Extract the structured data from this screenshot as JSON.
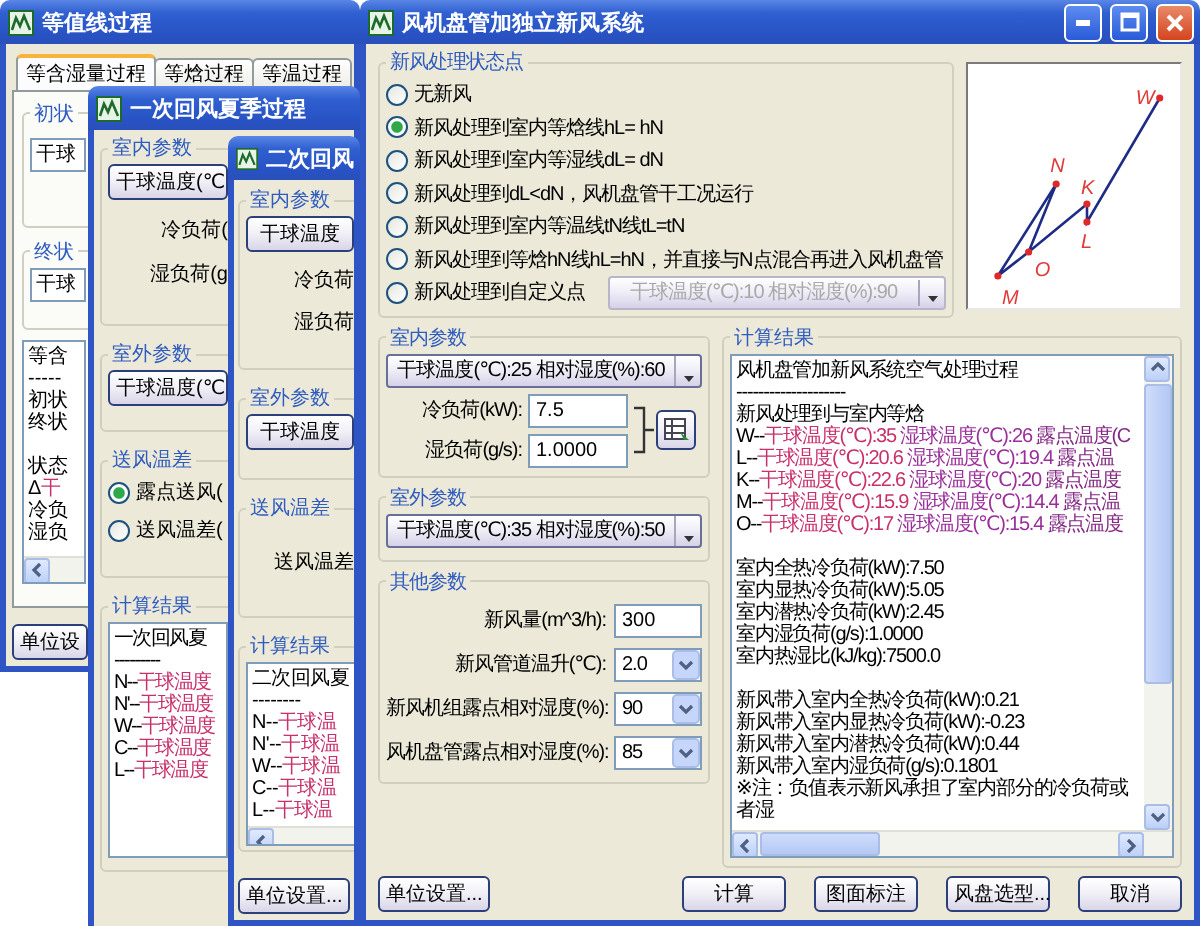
{
  "isoline_window": {
    "title": "等值线过程",
    "tabs": [
      {
        "label": "等含湿量过程",
        "selected": true
      },
      {
        "label": "等焓过程",
        "selected": false
      },
      {
        "label": "等温过程",
        "selected": false
      }
    ],
    "start_group": {
      "legend": "初状",
      "field": "干球"
    },
    "end_group": {
      "legend": "终状",
      "field": "干球"
    },
    "results": [
      {
        "kind": "plain",
        "text": "等含"
      },
      {
        "kind": "plain",
        "text": "-----"
      },
      {
        "kind": "plain",
        "text": "初状"
      },
      {
        "kind": "plain",
        "text": "终状"
      },
      {
        "kind": "blank"
      },
      {
        "kind": "plain",
        "text": "状态"
      },
      {
        "kind": "state",
        "prefix": "Δ",
        "parts": [
          "干"
        ]
      },
      {
        "kind": "plain",
        "text": "冷负"
      },
      {
        "kind": "plain",
        "text": "湿负"
      }
    ],
    "unit_button": "单位设"
  },
  "primary_window": {
    "title": "一次回风夏季过程",
    "indoor": {
      "legend": "室内参数",
      "button": "干球温度(℃",
      "cooling_label": "冷负荷(",
      "humidity_label": "湿负荷(g"
    },
    "outdoor": {
      "legend": "室外参数",
      "button": "干球温度(℃"
    },
    "supply": {
      "legend": "送风温差",
      "options": [
        {
          "label": "露点送风(",
          "selected": true
        },
        {
          "label": "送风温差(",
          "selected": false
        }
      ]
    },
    "results": {
      "legend": "计算结果",
      "lines": [
        {
          "kind": "plain",
          "text": "一次回风夏"
        },
        {
          "kind": "plain",
          "text": "---------"
        },
        {
          "kind": "state",
          "prefix": "N--",
          "parts": [
            "干球温度"
          ]
        },
        {
          "kind": "state",
          "prefix": "N'--",
          "parts": [
            "干球温度"
          ]
        },
        {
          "kind": "state",
          "prefix": "W--",
          "parts": [
            "干球温度"
          ]
        },
        {
          "kind": "state",
          "prefix": "C--",
          "parts": [
            "干球温度"
          ]
        },
        {
          "kind": "state",
          "prefix": "L--",
          "parts": [
            "干球温度"
          ]
        }
      ]
    }
  },
  "secondary_window": {
    "title": "二次回风",
    "indoor": {
      "legend": "室内参数",
      "button": "干球温度",
      "cooling_label": "冷负荷",
      "humidity_label": "湿负荷"
    },
    "outdoor": {
      "legend": "室外参数",
      "button": "干球温度"
    },
    "supply": {
      "legend": "送风温差",
      "label": "送风温差"
    },
    "results": {
      "legend": "计算结果",
      "lines": [
        {
          "kind": "plain",
          "text": "二次回风夏"
        },
        {
          "kind": "plain",
          "text": "--------"
        },
        {
          "kind": "state",
          "prefix": "N--",
          "parts": [
            "干球温"
          ]
        },
        {
          "kind": "state",
          "prefix": "N'--",
          "parts": [
            "干球温"
          ]
        },
        {
          "kind": "state",
          "prefix": "W--",
          "parts": [
            "干球温"
          ]
        },
        {
          "kind": "state",
          "prefix": "C--",
          "parts": [
            "干球温"
          ]
        },
        {
          "kind": "state",
          "prefix": "L--",
          "parts": [
            "干球温"
          ]
        }
      ]
    },
    "unit_button": "单位设置..."
  },
  "main_window": {
    "title": "风机盘管加独立新风系统",
    "treatment": {
      "legend": "新风处理状态点",
      "options": [
        {
          "label": "无新风",
          "selected": false
        },
        {
          "label": "新风处理到室内等焓线hL= hN",
          "selected": true
        },
        {
          "label": "新风处理到室内等湿线dL= dN",
          "selected": false
        },
        {
          "label": "新风处理到dL<dN，风机盘管干工况运行",
          "selected": false
        },
        {
          "label": "新风处理到室内等温线tN线tL=tN",
          "selected": false
        },
        {
          "label": "新风处理到等焓hN线hL=hN，并直接与N点混合再进入风机盘管",
          "selected": false
        },
        {
          "label": "新风处理到自定义点",
          "selected": false,
          "dropdown": {
            "value": "干球温度(℃):10 相对湿度(%):90",
            "disabled": true
          }
        }
      ]
    },
    "chart": {
      "point_labels": [
        "W",
        "N",
        "K",
        "L",
        "O",
        "M"
      ]
    },
    "indoor": {
      "legend": "室内参数",
      "dropdown": "干球温度(℃):25 相对湿度(%):60",
      "fields": [
        {
          "label": "冷负荷(kW):",
          "value": "7.5"
        },
        {
          "label": "湿负荷(g/s):",
          "value": "1.0000"
        }
      ]
    },
    "outdoor": {
      "legend": "室外参数",
      "dropdown": "干球温度(℃):35 相对湿度(%):50"
    },
    "other": {
      "legend": "其他参数",
      "rows": [
        {
          "kind": "text",
          "label": "新风量(m^3/h):",
          "value": "300"
        },
        {
          "kind": "combo",
          "label": "新风管道温升(℃):",
          "value": "2.0"
        },
        {
          "kind": "combo",
          "label": "新风机组露点相对湿度(%):",
          "value": "90"
        },
        {
          "kind": "combo",
          "label": "风机盘管露点相对湿度(%):",
          "value": "85"
        }
      ]
    },
    "results": {
      "legend": "计算结果",
      "lines": [
        {
          "kind": "plain",
          "text": "风机盘管加新风系统空气处理过程"
        },
        {
          "kind": "plain",
          "text": "--------------------"
        },
        {
          "kind": "plain",
          "text": "新风处理到与室内等焓"
        },
        {
          "kind": "state",
          "prefix": "W--",
          "parts": [
            "干球温度(℃):35",
            "湿球温度(℃):26",
            "露点温度(C"
          ]
        },
        {
          "kind": "state",
          "prefix": "L--",
          "parts": [
            "干球温度(℃):20.6",
            "湿球温度(℃):19.4",
            "露点温"
          ]
        },
        {
          "kind": "state",
          "prefix": "K--",
          "parts": [
            "干球温度(℃):22.6",
            "湿球温度(℃):20",
            "露点温度"
          ]
        },
        {
          "kind": "state",
          "prefix": "M--",
          "parts": [
            "干球温度(℃):15.9",
            "湿球温度(℃):14.4",
            "露点温"
          ]
        },
        {
          "kind": "state",
          "prefix": "O--",
          "parts": [
            "干球温度(℃):17",
            "湿球温度(℃):15.4",
            "露点温度"
          ]
        },
        {
          "kind": "blank"
        },
        {
          "kind": "plain",
          "text": "室内全热冷负荷(kW):7.50"
        },
        {
          "kind": "plain",
          "text": "室内显热冷负荷(kW):5.05"
        },
        {
          "kind": "plain",
          "text": "室内潜热冷负荷(kW):2.45"
        },
        {
          "kind": "plain",
          "text": "室内湿负荷(g/s):1.0000"
        },
        {
          "kind": "plain",
          "text": "室内热湿比(kJ/kg):7500.0"
        },
        {
          "kind": "blank"
        },
        {
          "kind": "plain",
          "text": "新风带入室内全热冷负荷(kW):0.21"
        },
        {
          "kind": "plain",
          "text": "新风带入室内显热冷负荷(kW):-0.23"
        },
        {
          "kind": "plain",
          "text": "新风带入室内潜热冷负荷(kW):0.44"
        },
        {
          "kind": "plain",
          "text": "新风带入室内湿负荷(g/s):0.1801"
        },
        {
          "kind": "plain",
          "text": "※注：负值表示新风承担了室内部分的冷负荷或者湿"
        }
      ]
    },
    "buttons": {
      "left": [
        "单位设置..."
      ],
      "right": [
        "计算",
        "图面标注",
        "风盘选型...",
        "取消"
      ]
    }
  }
}
